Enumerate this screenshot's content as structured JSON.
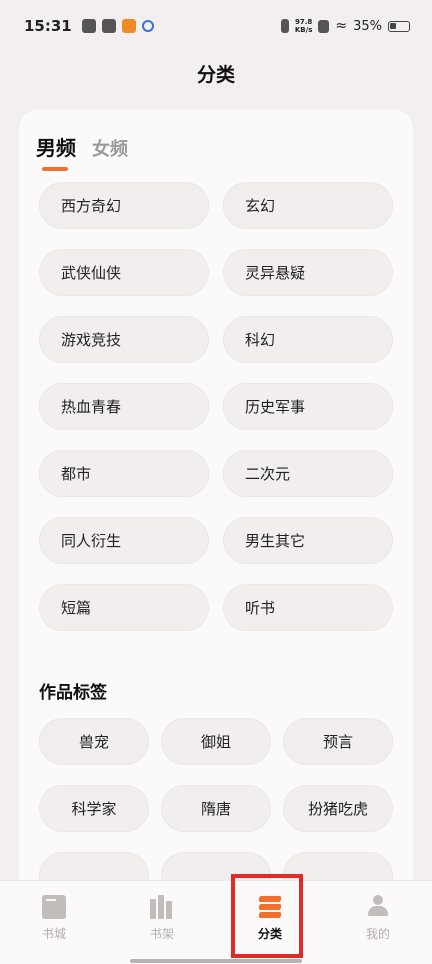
{
  "status_bar": {
    "time": "15:31",
    "net_speed_value": "97.8",
    "net_speed_unit": "KB/s",
    "battery": "35%"
  },
  "page": {
    "title": "分类"
  },
  "tabs": [
    {
      "label": "男频",
      "active": true
    },
    {
      "label": "女频",
      "active": false
    }
  ],
  "categories": [
    "西方奇幻",
    "玄幻",
    "武侠仙侠",
    "灵异悬疑",
    "游戏竞技",
    "科幻",
    "热血青春",
    "历史军事",
    "都市",
    "二次元",
    "同人衍生",
    "男生其它",
    "短篇",
    "听书"
  ],
  "tags_section": {
    "title": "作品标签",
    "tags": [
      "兽宠",
      "御姐",
      "预言",
      "科学家",
      "隋唐",
      "扮猪吃虎"
    ]
  },
  "bottom_nav": [
    {
      "label": "书城",
      "icon": "book-icon",
      "active": false
    },
    {
      "label": "书架",
      "icon": "bookshelf-icon",
      "active": false
    },
    {
      "label": "分类",
      "icon": "layers-icon",
      "active": true
    },
    {
      "label": "我的",
      "icon": "user-icon",
      "active": false
    }
  ],
  "colors": {
    "accent": "#f0702d",
    "highlight": "#e02b2b"
  }
}
